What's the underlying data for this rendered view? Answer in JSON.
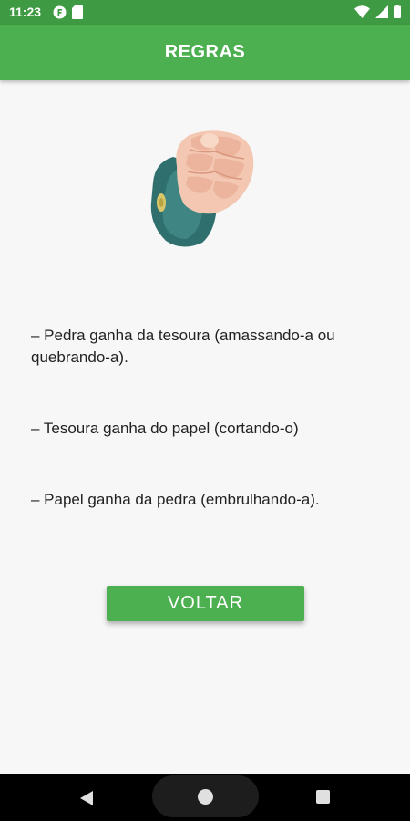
{
  "status_bar": {
    "time": "11:23",
    "left_icons": [
      "notification-f-icon",
      "sd-card-icon"
    ],
    "right_icons": [
      "wifi-icon",
      "signal-icon",
      "battery-icon"
    ]
  },
  "app_bar": {
    "title": "REGRAS"
  },
  "illustration": {
    "icon": "pointing-hand-icon"
  },
  "rules": [
    "– Pedra ganha da tesoura (amassando-a ou quebrando-a).",
    "– Tesoura ganha do papel (cortando-o)",
    "– Papel ganha da pedra (embrulhando-a)."
  ],
  "back_button": {
    "label": "VOLTAR"
  },
  "nav_bar": {
    "buttons": [
      "back-icon",
      "home-icon",
      "recents-icon"
    ]
  },
  "colors": {
    "status_bar": "#3f9b43",
    "primary": "#4caf50",
    "background": "#f7f7f7",
    "text": "#222222"
  }
}
